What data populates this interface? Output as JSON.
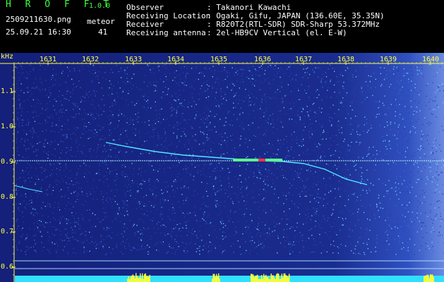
{
  "header": {
    "app_name": "H R O F F T",
    "version": "1.0.0",
    "filename": "2509211630.png",
    "datetime": "25.09.21 16:30",
    "meteor_label": "meteor",
    "meteor_count": "41",
    "info": [
      {
        "key": "Observer",
        "value": ": Takanori Kawachi"
      },
      {
        "key": "Receiving Location",
        "value": ": Ogaki, Gifu, JAPAN (136.60E, 35.35N)"
      },
      {
        "key": "Receiver",
        "value": ": R820T2(RTL-SDR) SDR-Sharp 53.372MHz"
      },
      {
        "key": "Receiving antenna",
        "value": ": 2el-HB9CV Vertical (el. E-W)"
      }
    ]
  },
  "chart_data": {
    "type": "heatmap",
    "ylabel": "kHz",
    "x_ticks": [
      "1631",
      "1632",
      "1633",
      "1634",
      "1635",
      "1636",
      "1637",
      "1638",
      "1639",
      "1640"
    ],
    "y_ticks": [
      "1.1",
      "1.0",
      "0.9",
      "0.8",
      "0.7",
      "0.6"
    ],
    "ylim": [
      0.57,
      1.19
    ],
    "colors": {
      "background": "#1a2a8a",
      "signal": "#40e0ff",
      "axis": "#ffff40",
      "text_green": "#3cff3c"
    }
  }
}
